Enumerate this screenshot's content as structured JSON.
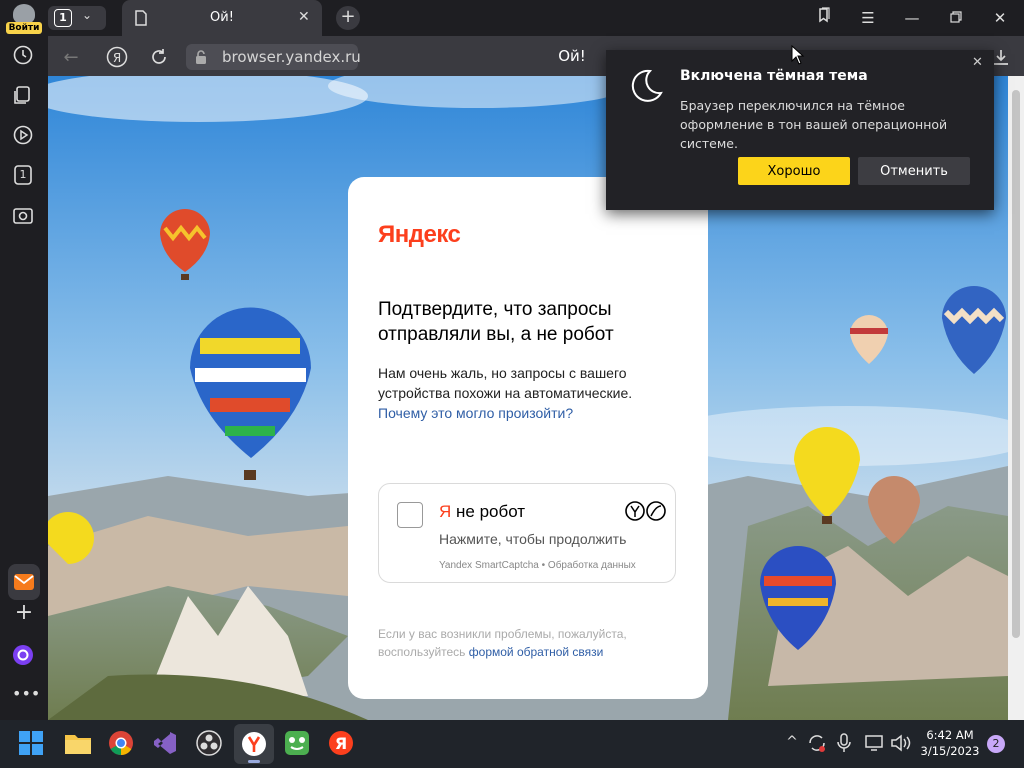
{
  "titlebar": {
    "login_label": "Войти",
    "tab_count": "1",
    "active_tab_title": "Ой!"
  },
  "address": {
    "url": "browser.yandex.ru",
    "page_title": "Ой!"
  },
  "sidebar": {
    "counter": "1"
  },
  "captcha_page": {
    "logo": "Яндекс",
    "heading": "Подтвердите, что запросы отправляли вы, а не робот",
    "description": "Нам очень жаль, но запросы с вашего устройства похожи на автоматические.",
    "description_link": "Почему это могло произойти?",
    "checkbox_prefix": "Я",
    "checkbox_label": "не робот",
    "continue_hint": "Нажмите, чтобы продолжить",
    "smartcaptcha_line": "Yandex SmartCaptcha • Обработка данных",
    "footer_text": "Если у вас возникли проблемы, пожалуйста, воспользуйтесь",
    "footer_link": "формой обратной связи"
  },
  "popup": {
    "title": "Включена тёмная тема",
    "text": "Браузер переключился на тёмное оформление в тон вашей операционной системе.",
    "ok_label": "Хорошо",
    "cancel_label": "Отменить"
  },
  "taskbar": {
    "time": "6:42 AM",
    "date": "3/15/2023",
    "notification_count": "2"
  },
  "colors": {
    "accent_yellow": "#fcd41a",
    "yandex_red": "#fc3f1d",
    "link_blue": "#2f5ea6"
  }
}
